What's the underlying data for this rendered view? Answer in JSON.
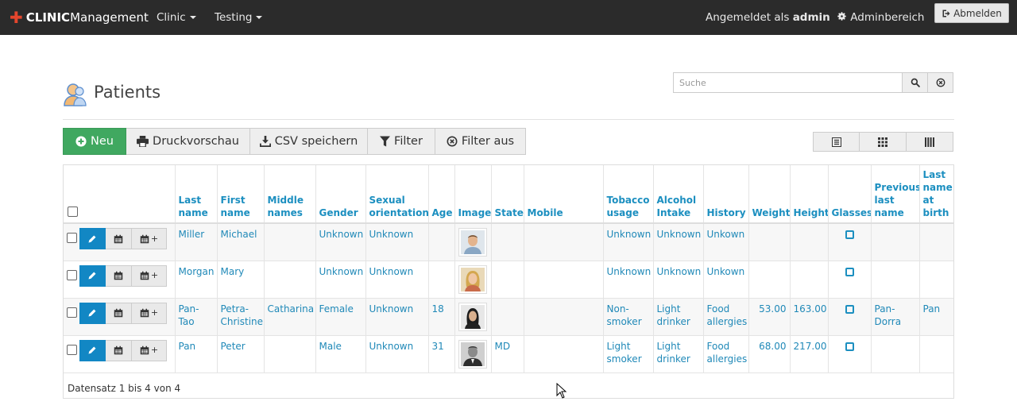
{
  "navbar": {
    "brand_bold": "CLINIC",
    "brand_rest": "Management",
    "menu_clinic": "Clinic",
    "menu_testing": "Testing",
    "logged_in_prefix": "Angemeldet als",
    "logged_in_user": "admin",
    "admin_area": "Adminbereich",
    "logout": "Abmelden"
  },
  "page": {
    "title": "Patients"
  },
  "search": {
    "placeholder": "Suche"
  },
  "toolbar": {
    "new": "Neu",
    "print_preview": "Druckvorschau",
    "csv_save": "CSV speichern",
    "filter": "Filter",
    "filter_off": "Filter aus"
  },
  "table": {
    "headers": {
      "last_name": "Last name",
      "first_name": "First name",
      "middle_names": "Middle names",
      "gender": "Gender",
      "sexual_orientation": "Sexual orientation",
      "age": "Age",
      "image": "Image",
      "state": "State",
      "mobile": "Mobile",
      "tobacco": "Tobacco usage",
      "alcohol": "Alcohol Intake",
      "history": "History",
      "weight": "Weight",
      "height": "Height",
      "glasses": "Glasses",
      "prev_last_name": "Previous last name",
      "last_name_birth": "Last name at birth"
    },
    "rows": [
      {
        "last_name": "Miller",
        "first_name": "Michael",
        "middle": "",
        "gender": "Unknown",
        "orientation": "Unknown",
        "age": "",
        "state": "",
        "mobile": "",
        "tobacco": "Unknown",
        "alcohol": "Unknown",
        "history": "Unkown",
        "weight": "",
        "height": "",
        "prev": "",
        "birth": ""
      },
      {
        "last_name": "Morgan",
        "first_name": "Mary",
        "middle": "",
        "gender": "Unknown",
        "orientation": "Unknown",
        "age": "",
        "state": "",
        "mobile": "",
        "tobacco": "Unknown",
        "alcohol": "Unknown",
        "history": "Unkown",
        "weight": "",
        "height": "",
        "prev": "",
        "birth": ""
      },
      {
        "last_name": "Pan-Tao",
        "first_name": "Petra-Christine",
        "middle": "Catharina",
        "gender": "Female",
        "orientation": "Unknown",
        "age": "18",
        "state": "",
        "mobile": "",
        "tobacco": "Non-smoker",
        "alcohol": "Light drinker",
        "history": "Food allergies",
        "weight": "53.00",
        "height": "163.00",
        "prev": "Pan-Dorra",
        "birth": "Pan"
      },
      {
        "last_name": "Pan",
        "first_name": "Peter",
        "middle": "",
        "gender": "Male",
        "orientation": "Unknown",
        "age": "31",
        "state": "MD",
        "mobile": "",
        "tobacco": "Light smoker",
        "alcohol": "Light drinker",
        "history": "Food allergies",
        "weight": "68.00",
        "height": "217.00",
        "prev": "",
        "birth": ""
      }
    ],
    "footer": "Datensatz 1 bis 4 von 4"
  },
  "colors": {
    "navbar": "#2b2b2b",
    "accent_red": "#e4462d",
    "link_blue": "#2089b8",
    "new_green": "#40a860",
    "edit_blue": "#1287c4"
  }
}
